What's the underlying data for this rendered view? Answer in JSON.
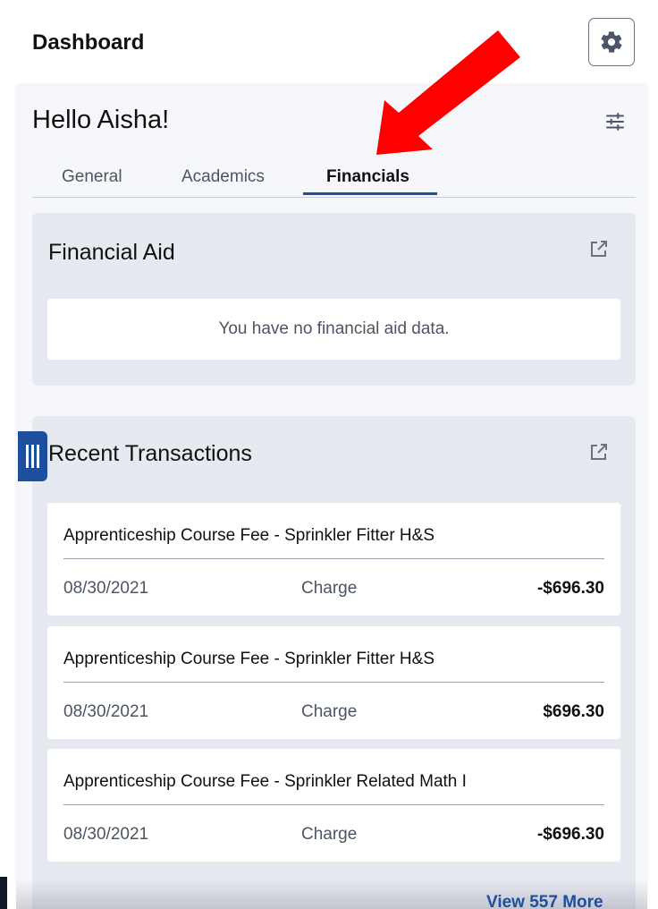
{
  "header": {
    "title": "Dashboard",
    "settings_icon": "gear-icon"
  },
  "greeting": "Hello Aisha!",
  "filter_icon": "sliders-icon",
  "tabs": [
    {
      "label": "General",
      "active": false
    },
    {
      "label": "Academics",
      "active": false
    },
    {
      "label": "Financials",
      "active": true
    }
  ],
  "financial_aid": {
    "title": "Financial Aid",
    "empty_message": "You have no financial aid data.",
    "link_icon": "external-link-icon"
  },
  "recent_transactions": {
    "title": "Recent Transactions",
    "link_icon": "external-link-icon",
    "items": [
      {
        "description": "Apprenticeship Course Fee - Sprinkler Fitter H&S",
        "date": "08/30/2021",
        "type": "Charge",
        "amount": "-$696.30"
      },
      {
        "description": "Apprenticeship Course Fee - Sprinkler Fitter H&S",
        "date": "08/30/2021",
        "type": "Charge",
        "amount": "$696.30"
      },
      {
        "description": "Apprenticeship Course Fee - Sprinkler Related Math I",
        "date": "08/30/2021",
        "type": "Charge",
        "amount": "-$696.30"
      }
    ],
    "view_more": "View 557 More"
  },
  "colors": {
    "accent": "#1e4f9c",
    "annotation_arrow": "#ff0000",
    "card_bg": "#e7e9f1"
  }
}
